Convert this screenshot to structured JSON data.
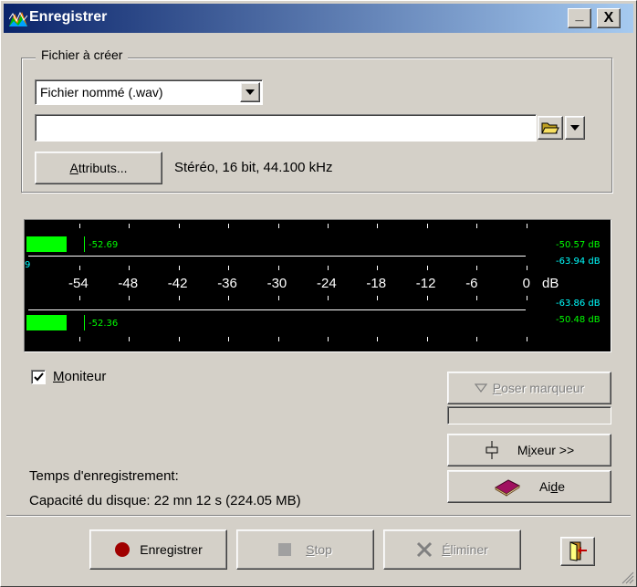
{
  "window": {
    "title": "Enregistrer",
    "minimize_label": "_",
    "close_label": "X"
  },
  "group": {
    "label": "Fichier à créer",
    "type_select_value": "Fichier nommé (.wav)",
    "path_value": "",
    "attributes_button": {
      "accel": "A",
      "rest": "ttributs..."
    },
    "attributes_text": "Stéréo, 16 bit, 44.100 kHz"
  },
  "meter": {
    "top": {
      "level_label": "-52.69",
      "level_fraction": 0.08,
      "peak_db": "-50.57 dB",
      "rms_db": "-63.94 dB"
    },
    "bottom": {
      "level_label": "-52.36",
      "level_fraction": 0.08,
      "peak_db": "-50.48 dB",
      "rms_db": "-63.86 dB"
    },
    "edge_label": "9",
    "scale_labels": [
      "-54",
      "-48",
      "-42",
      "-36",
      "-30",
      "-24",
      "-18",
      "-12",
      "-6",
      "0"
    ],
    "unit": "dB",
    "colors": {
      "level": "#00ff00",
      "readout": "#00ffff",
      "background": "#000000"
    }
  },
  "monitor": {
    "checked": true,
    "accel": "M",
    "rest": "oniteur"
  },
  "right_buttons": {
    "marker": {
      "accel": "P",
      "rest": "oser marqueur",
      "icon": "triangle-down-icon"
    },
    "mixer": {
      "pre": "M",
      "accel": "i",
      "rest": "xeur >>",
      "icon": "fader-icon"
    },
    "help": {
      "pre": "Ai",
      "accel": "d",
      "rest": "e",
      "icon": "book-icon"
    }
  },
  "info": {
    "record_time_label": "Temps d'enregistrement:",
    "disk_capacity_label": "Capacité du disque: 22 mn 12 s (224.05 MB)"
  },
  "bottom_bar": {
    "record_label": "Enregistrer",
    "stop": {
      "accel": "S",
      "rest": "top"
    },
    "delete": {
      "accel": "É",
      "rest": "liminer"
    }
  }
}
